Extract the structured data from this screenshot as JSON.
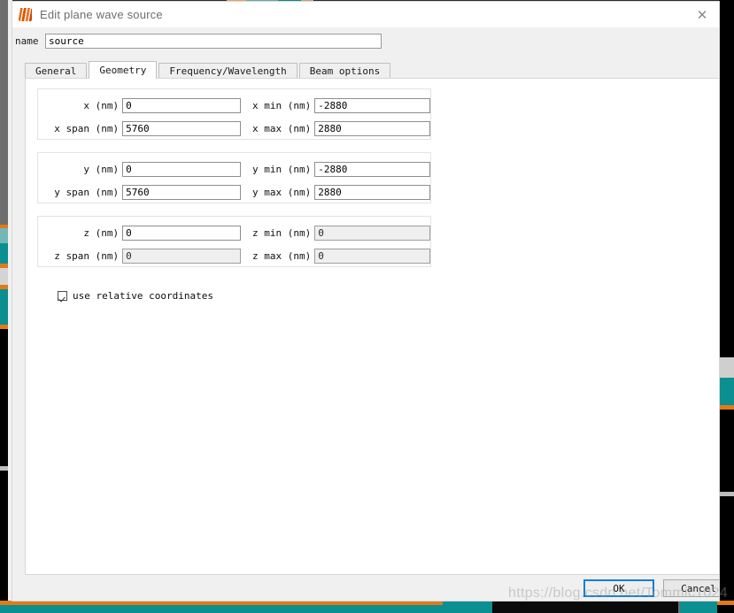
{
  "window": {
    "title": "Edit plane wave source",
    "app_icon": "lumerical-flame-icon",
    "close_label": "✕"
  },
  "name_field": {
    "label": "name",
    "value": "source",
    "placeholder": ""
  },
  "tabs": [
    {
      "label": "General",
      "active": false
    },
    {
      "label": "Geometry",
      "active": true
    },
    {
      "label": "Frequency/Wavelength",
      "active": false
    },
    {
      "label": "Beam options",
      "active": false
    }
  ],
  "groups": [
    {
      "axis": "x",
      "rows": [
        {
          "left_label": "x (nm)",
          "left_value": "0",
          "left_disabled": false,
          "right_label": "x min (nm)",
          "right_value": "-2880",
          "right_disabled": false
        },
        {
          "left_label": "x span (nm)",
          "left_value": "5760",
          "left_disabled": false,
          "right_label": "x max (nm)",
          "right_value": "2880",
          "right_disabled": false
        }
      ]
    },
    {
      "axis": "y",
      "rows": [
        {
          "left_label": "y (nm)",
          "left_value": "0",
          "left_disabled": false,
          "right_label": "y min (nm)",
          "right_value": "-2880",
          "right_disabled": false
        },
        {
          "left_label": "y span (nm)",
          "left_value": "5760",
          "left_disabled": false,
          "right_label": "y max (nm)",
          "right_value": "2880",
          "right_disabled": false
        }
      ]
    },
    {
      "axis": "z",
      "rows": [
        {
          "left_label": "z (nm)",
          "left_value": "0",
          "left_disabled": false,
          "right_label": "z min (nm)",
          "right_value": "0",
          "right_disabled": true
        },
        {
          "left_label": "z span (nm)",
          "left_value": "0",
          "left_disabled": true,
          "right_label": "z max (nm)",
          "right_value": "0",
          "right_disabled": true
        }
      ]
    }
  ],
  "relative_coords": {
    "label": "use relative coordinates",
    "checked": true
  },
  "footer": {
    "ok_label": "OK",
    "cancel_label": "Cancel"
  },
  "watermark": "https://blog.csdn.net/Tommic1024",
  "colors": {
    "accent_focus": "#0f7fd4",
    "teal": "#0a9396",
    "orange": "#e07b1a",
    "title_text": "#6e6e6e"
  }
}
